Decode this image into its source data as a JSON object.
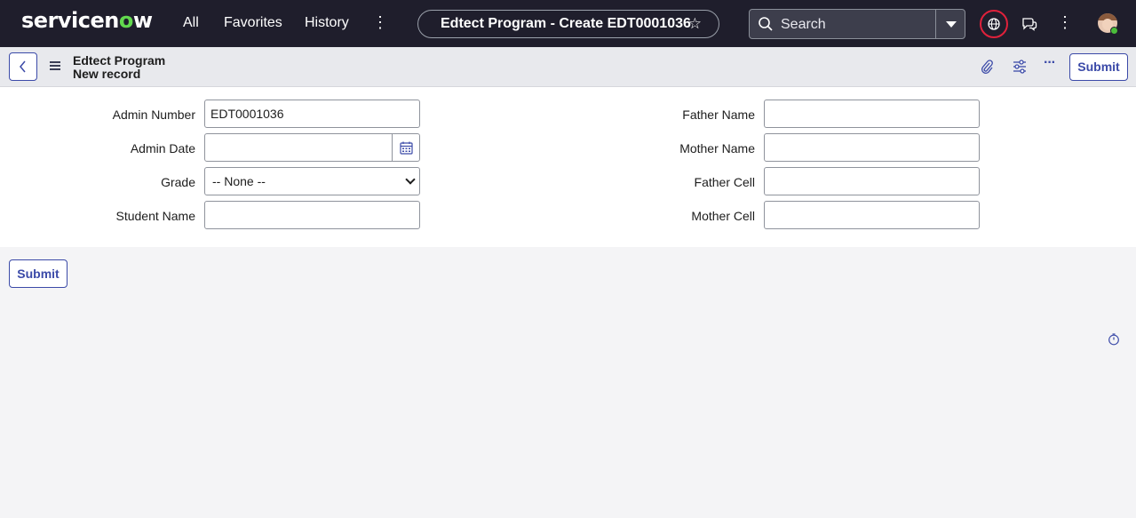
{
  "nav": {
    "logo_text": "servicen",
    "logo_o": "o",
    "logo_w": "w",
    "all": "All",
    "favorites": "Favorites",
    "history": "History",
    "more": "⋮",
    "page_title": "Edtect Program - Create EDT0001036",
    "search_placeholder": "Search",
    "accent_color": "#62d84e",
    "highlight_color": "#e0213b"
  },
  "header": {
    "table_label": "Edtect Program",
    "record_label": "New record",
    "submit_label": "Submit",
    "more": "···"
  },
  "form": {
    "left": [
      {
        "label": "Admin Number",
        "value": "EDT0001036"
      },
      {
        "label": "Admin Date",
        "value": ""
      },
      {
        "label": "Grade",
        "value": "-- None --"
      },
      {
        "label": "Student Name",
        "value": ""
      }
    ],
    "right": [
      {
        "label": "Father Name",
        "value": ""
      },
      {
        "label": "Mother Name",
        "value": ""
      },
      {
        "label": "Father Cell",
        "value": ""
      },
      {
        "label": "Mother Cell",
        "value": ""
      }
    ]
  },
  "footer": {
    "submit_label": "Submit"
  }
}
